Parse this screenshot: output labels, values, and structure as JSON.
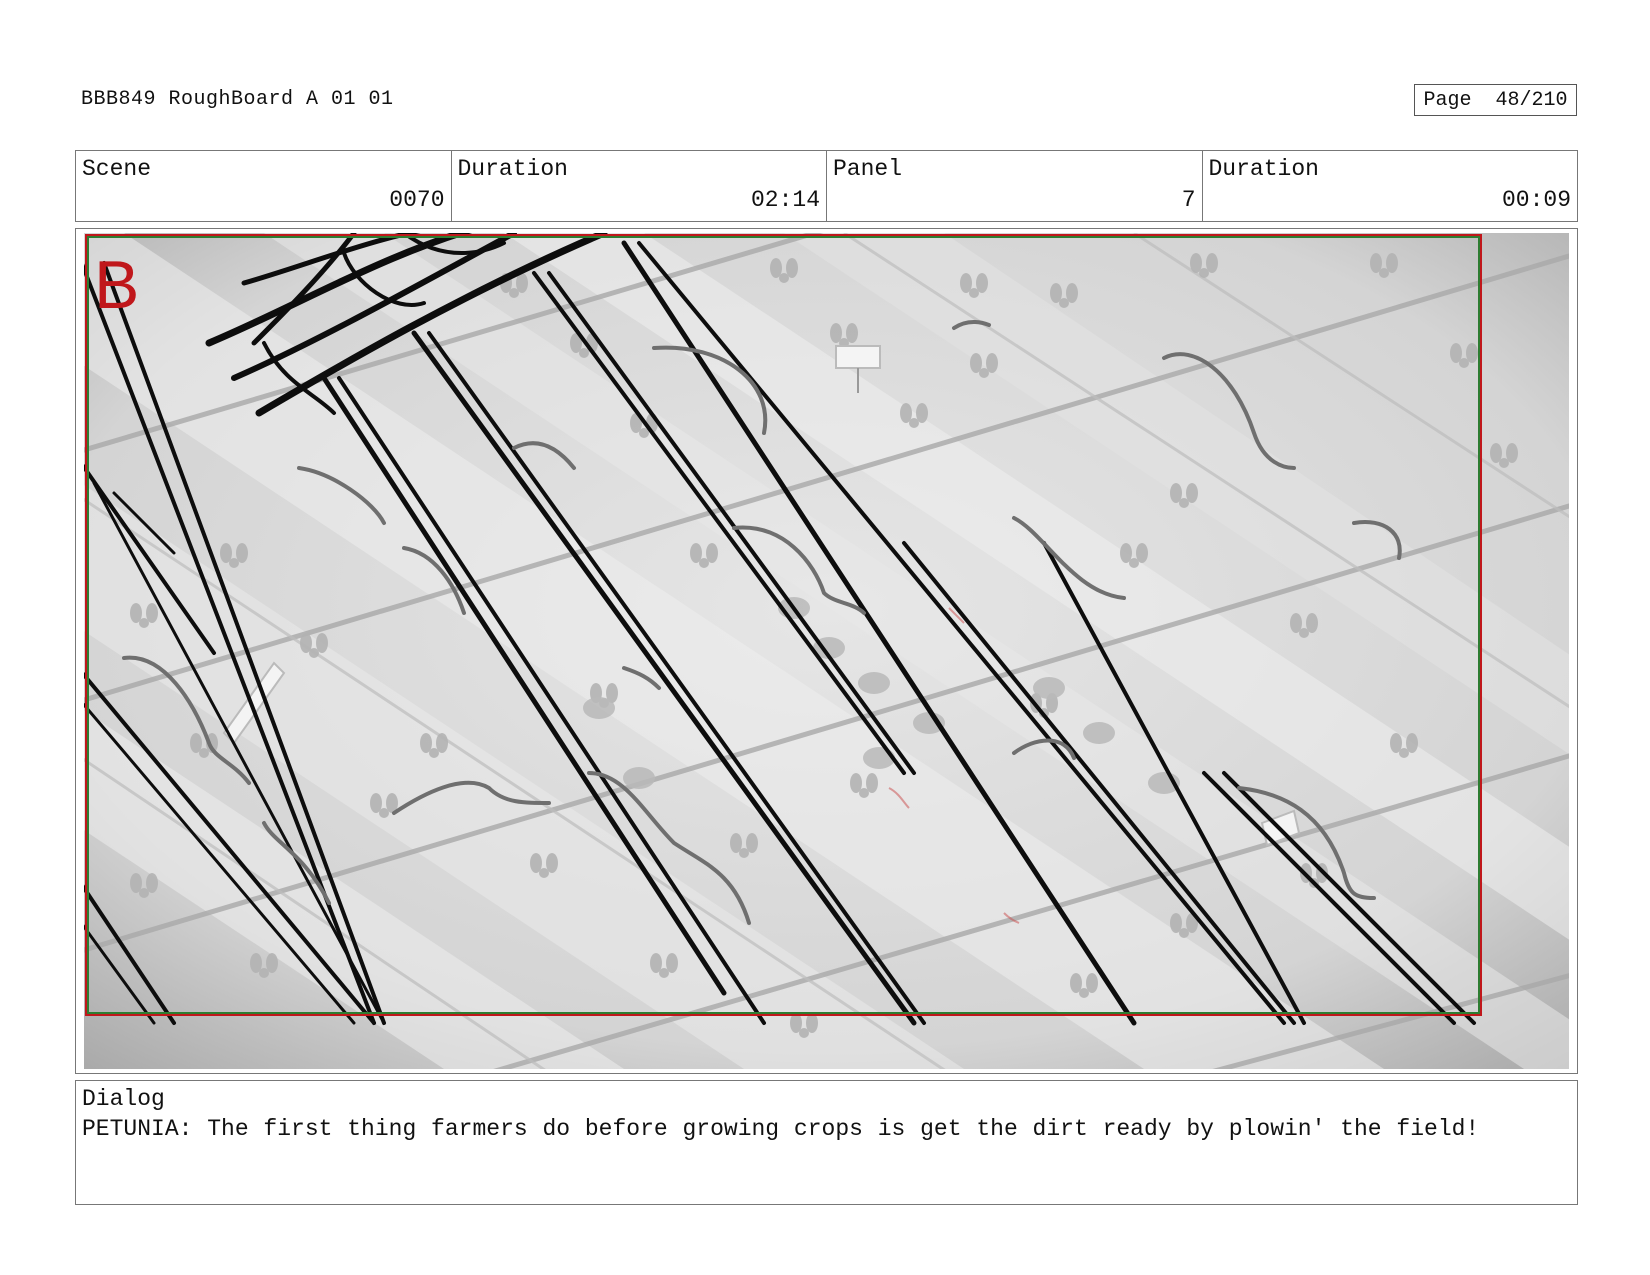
{
  "header": {
    "title": "BBB849 RoughBoard A 01 01",
    "page": "Page  48/210"
  },
  "info": {
    "scene_label": "Scene",
    "scene_value": "0070",
    "scene_duration_label": "Duration",
    "scene_duration_value": "02:14",
    "panel_label": "Panel",
    "panel_value": "7",
    "panel_duration_label": "Duration",
    "panel_duration_value": "00:09"
  },
  "panel": {
    "marker": "B",
    "marker_color": "#c0171b",
    "safe_frame_colors": [
      "#c0171b",
      "#2e7d32"
    ]
  },
  "dialog": {
    "label": "Dialog",
    "text": "PETUNIA: The first thing farmers do before growing crops is get the dirt ready by plowin' the field!"
  }
}
